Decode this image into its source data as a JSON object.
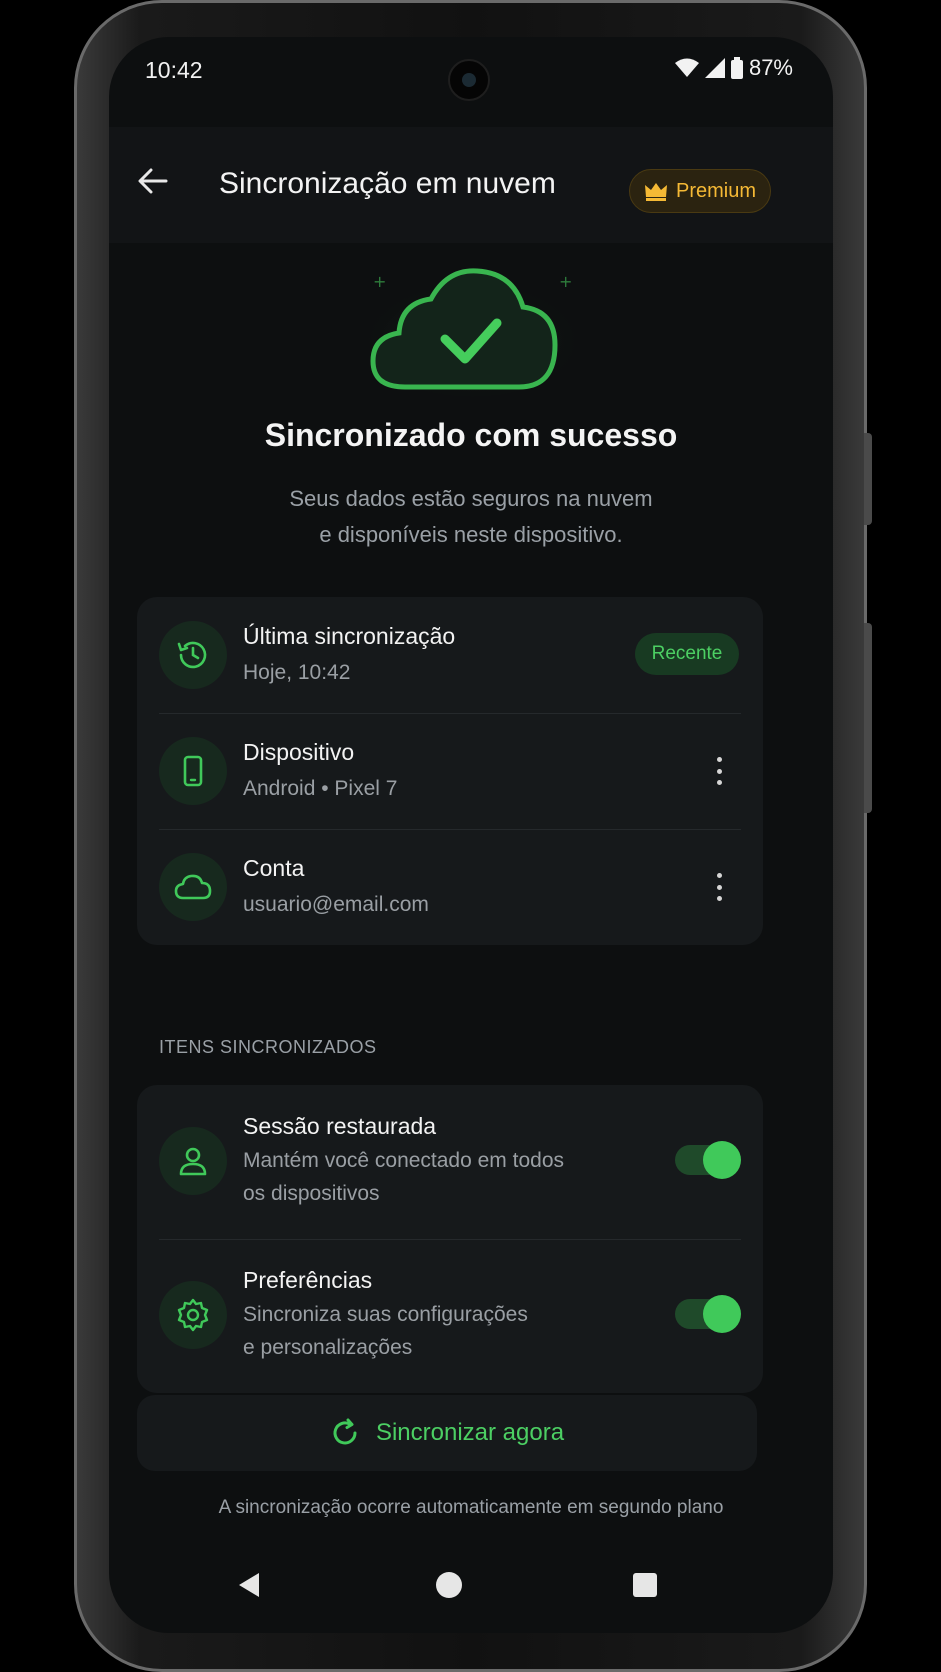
{
  "status_bar": {
    "time": "10:42",
    "battery": "87%"
  },
  "app_bar": {
    "title": "Sincronização em nuvem",
    "premium_label": "Premium"
  },
  "hero": {
    "title": "Sincronizado com sucesso",
    "subtitle_line1": "Seus dados estão seguros na nuvem",
    "subtitle_line2": "e disponíveis neste dispositivo."
  },
  "info": {
    "last_sync": {
      "title": "Última sincronização",
      "value": "Hoje, 10:42",
      "badge": "Recente",
      "icon": "history-icon"
    },
    "device": {
      "title": "Dispositivo",
      "value": "Android • Pixel 7",
      "icon": "phone-icon"
    },
    "account": {
      "title": "Conta",
      "value": "usuario@email.com",
      "icon": "cloud-icon"
    }
  },
  "synced_items": {
    "section_label": "ITENS SINCRONIZADOS",
    "items": [
      {
        "title": "Sessão restaurada",
        "desc_line1": "Mantém você conectado em todos",
        "desc_line2": "os dispositivos",
        "enabled": true,
        "icon": "user-icon"
      },
      {
        "title": "Preferências",
        "desc_line1": "Sincroniza suas configurações",
        "desc_line2": "e personalizações",
        "enabled": true,
        "icon": "gear-icon"
      }
    ]
  },
  "actions": {
    "sync_now": "Sincronizar agora"
  },
  "footnote": "A sincronização ocorre automaticamente em segundo plano",
  "colors": {
    "accent": "#40c95a",
    "premium": "#f5b935",
    "background": "#0d0f10",
    "card": "#16191b"
  }
}
